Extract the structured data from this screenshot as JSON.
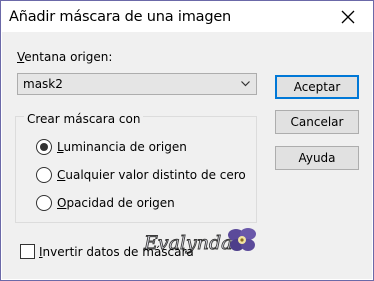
{
  "window": {
    "title": "Añadir máscara de una imagen"
  },
  "source": {
    "label_hotkey": "V",
    "label_rest": "entana origen:",
    "selected": "mask2"
  },
  "buttons": {
    "ok": "Aceptar",
    "cancel": "Cancelar",
    "help": "Ayuda"
  },
  "group": {
    "title": "Crear máscara con",
    "options": [
      {
        "hotkey": "L",
        "rest": "uminancia de origen",
        "checked": true
      },
      {
        "hotkey": "C",
        "rest": "ualquier valor distinto de cero",
        "checked": false
      },
      {
        "hotkey": "O",
        "rest": "pacidad de origen",
        "checked": false
      }
    ]
  },
  "invert": {
    "hotkey": "I",
    "rest": "nvertir datos de máscara",
    "checked": false
  },
  "watermark": {
    "text": "Evalynda"
  },
  "icons": {
    "close": "close-icon",
    "dropdown": "chevron-down-icon",
    "watermark_flower": "flower-icon"
  }
}
